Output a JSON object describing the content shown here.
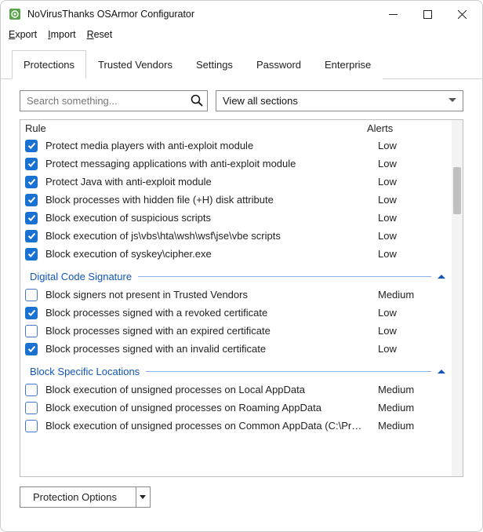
{
  "window": {
    "title": "NoVirusThanks OSArmor Configurator"
  },
  "menu": {
    "export": "Export",
    "import": "Import",
    "reset": "Reset"
  },
  "tabs": {
    "protections": "Protections",
    "trusted_vendors": "Trusted Vendors",
    "settings": "Settings",
    "password": "Password",
    "enterprise": "Enterprise"
  },
  "search": {
    "placeholder": "Search something..."
  },
  "section_filter": {
    "selected": "View all sections"
  },
  "columns": {
    "rule": "Rule",
    "alerts": "Alerts"
  },
  "groups": {
    "digital_code_sig": "Digital Code Signature",
    "block_locations": "Block Specific Locations"
  },
  "rules_top": [
    {
      "checked": true,
      "label": "Protect media players with anti-exploit module",
      "alert": "Low"
    },
    {
      "checked": true,
      "label": "Protect messaging applications with anti-exploit module",
      "alert": "Low"
    },
    {
      "checked": true,
      "label": "Protect Java with anti-exploit module",
      "alert": "Low"
    },
    {
      "checked": true,
      "label": "Block processes with hidden file (+H) disk attribute",
      "alert": "Low"
    },
    {
      "checked": true,
      "label": "Block execution of suspicious scripts",
      "alert": "Low"
    },
    {
      "checked": true,
      "label": "Block execution of js\\vbs\\hta\\wsh\\wsf\\jse\\vbe scripts",
      "alert": "Low"
    },
    {
      "checked": true,
      "label": "Block execution of syskey\\cipher.exe",
      "alert": "Low"
    }
  ],
  "rules_sig": [
    {
      "checked": false,
      "label": "Block signers not present in Trusted Vendors",
      "alert": "Medium"
    },
    {
      "checked": true,
      "label": "Block processes signed with a revoked certificate",
      "alert": "Low"
    },
    {
      "checked": false,
      "label": "Block processes signed with an expired certificate",
      "alert": "Low"
    },
    {
      "checked": true,
      "label": "Block processes signed with an invalid certificate",
      "alert": "Low"
    }
  ],
  "rules_loc": [
    {
      "checked": false,
      "label": "Block execution of unsigned processes on Local AppData",
      "alert": "Medium"
    },
    {
      "checked": false,
      "label": "Block execution of unsigned processes on Roaming AppData",
      "alert": "Medium"
    },
    {
      "checked": false,
      "label": "Block execution of unsigned processes on Common AppData (C:\\Pr…",
      "alert": "Medium"
    }
  ],
  "footer": {
    "options_label": "Protection Options"
  }
}
